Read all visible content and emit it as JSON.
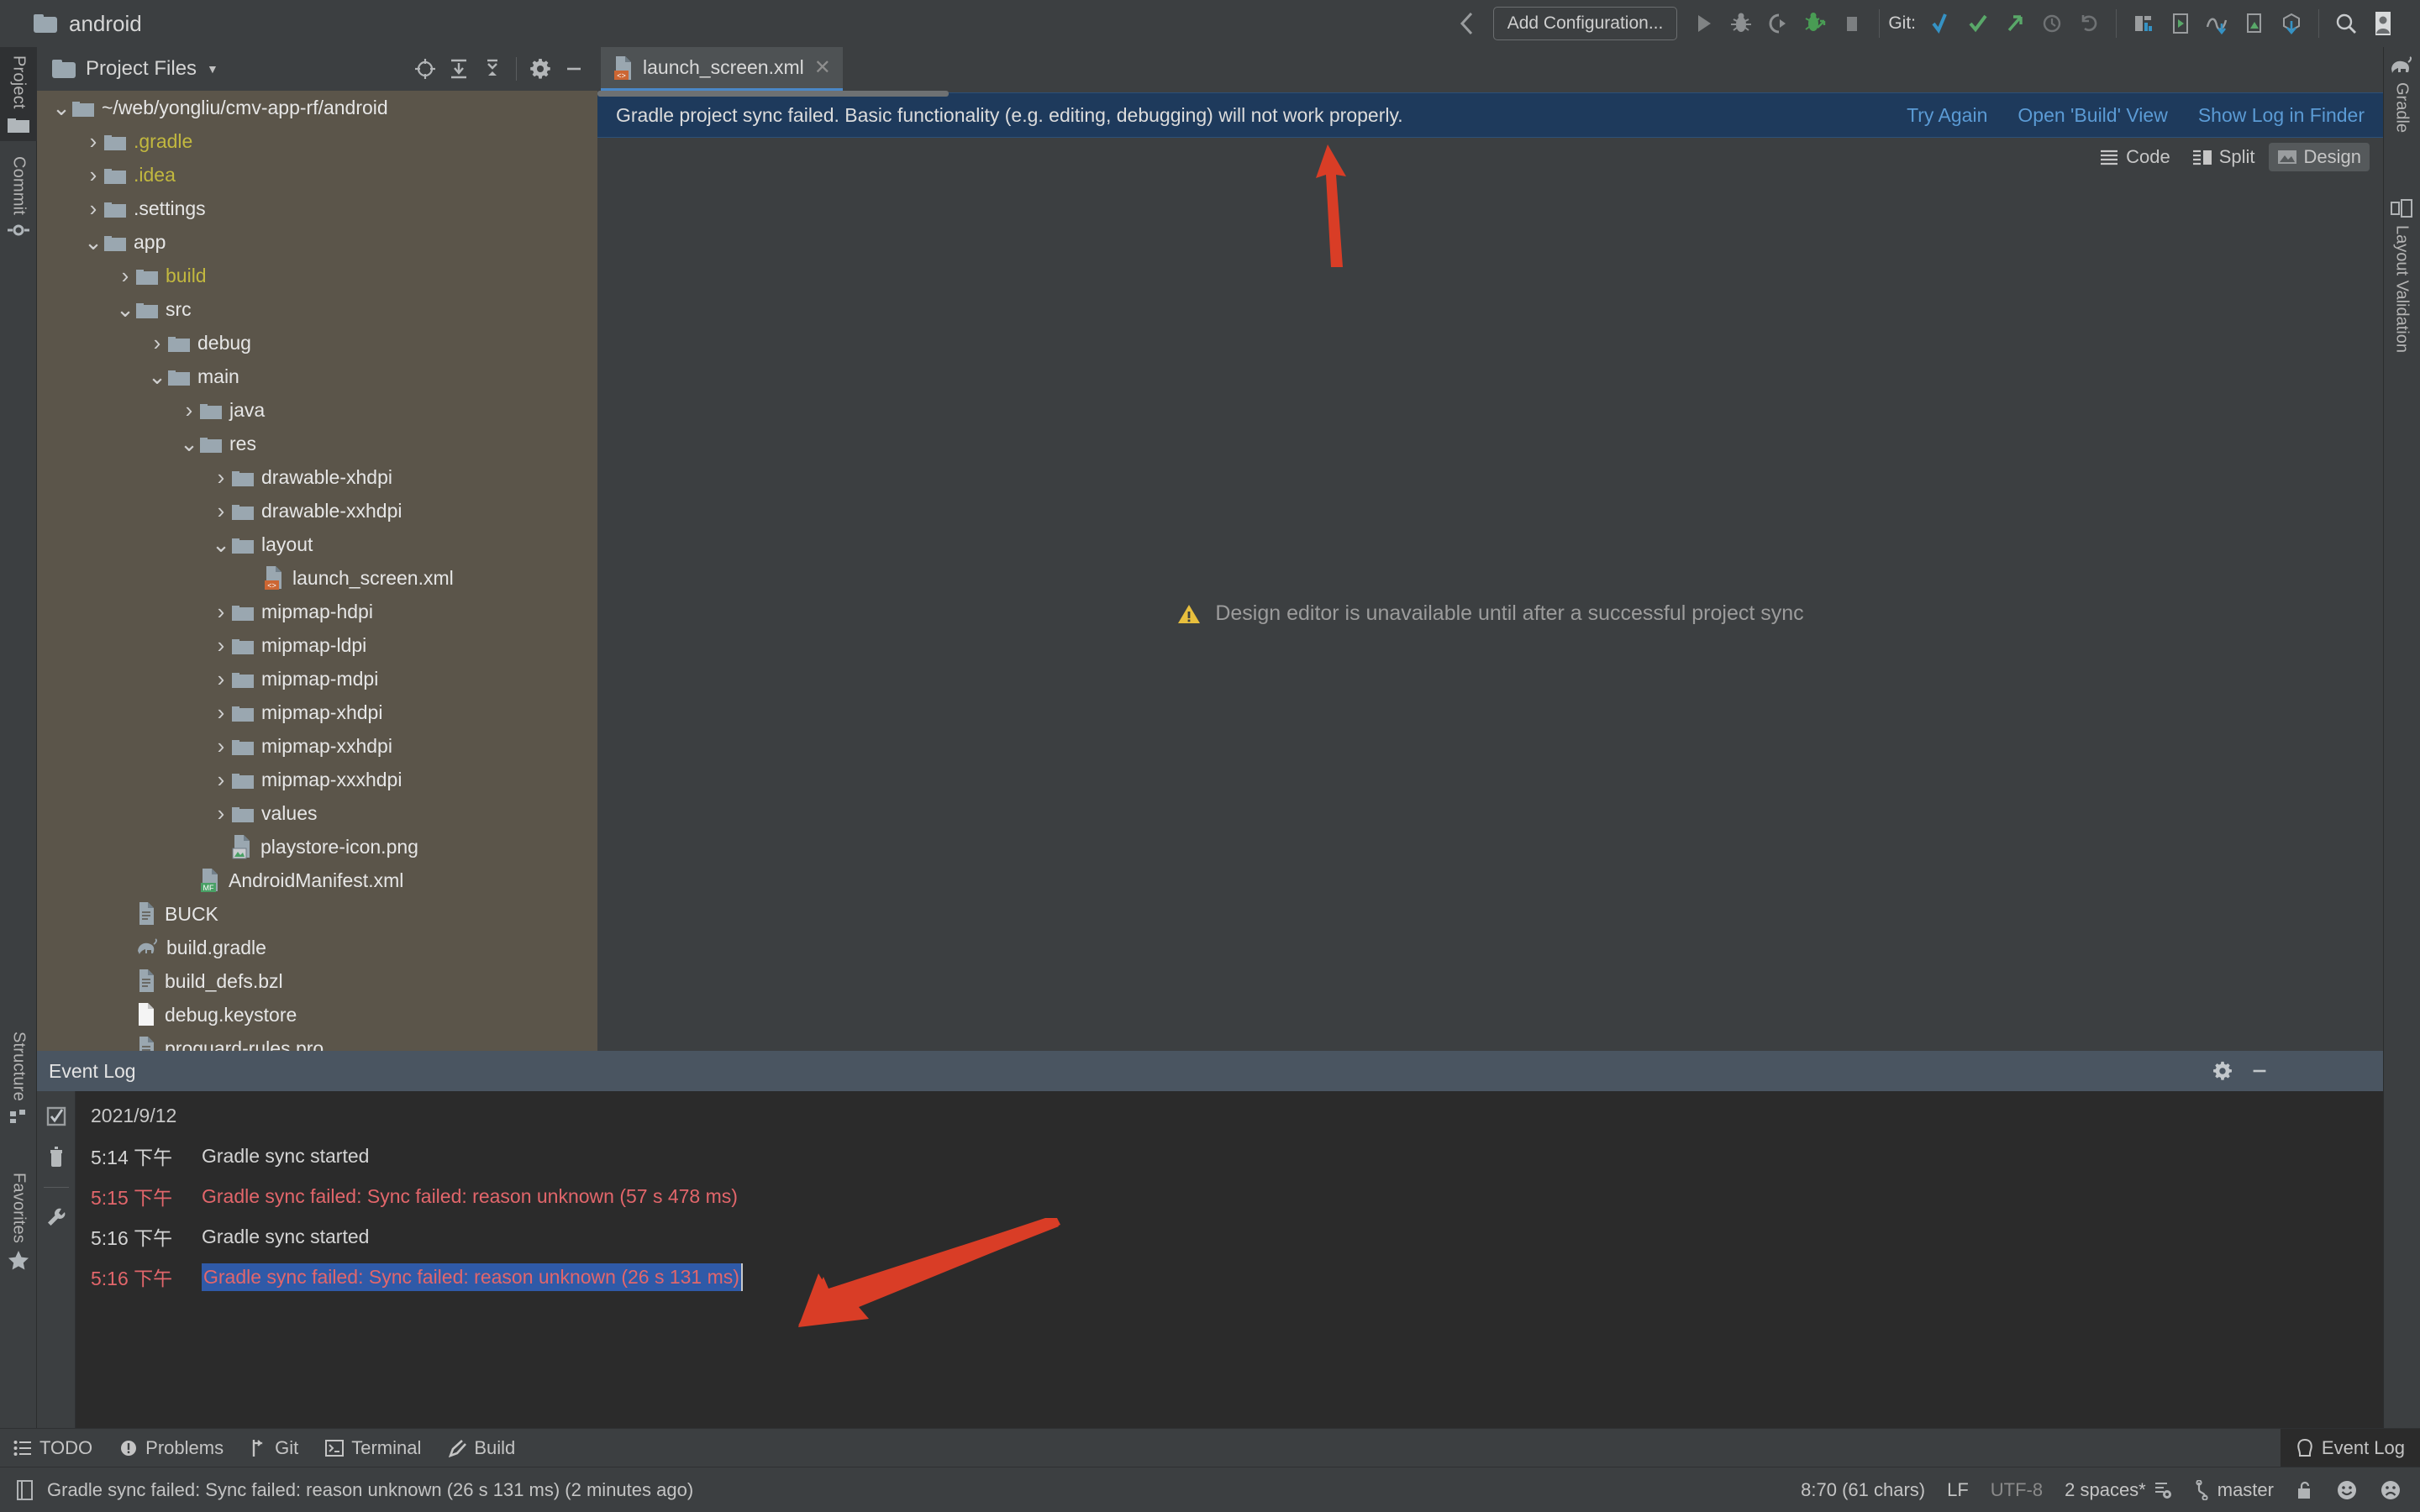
{
  "window": {
    "project_name": "android"
  },
  "toolbar": {
    "add_configuration": "Add Configuration...",
    "git_label": "Git:",
    "icons": [
      "back-arrow-icon",
      "run-icon",
      "debug-icon",
      "run-coverage-icon",
      "profile-icon",
      "stop-icon",
      "git-update-icon",
      "git-commit-icon",
      "git-push-icon",
      "git-history-icon",
      "git-rollback-icon",
      "sdk-manager-icon",
      "avd-manager-icon",
      "device-explorer-icon",
      "layout-inspector-icon",
      "apk-analyzer-icon",
      "search-icon",
      "profile-avatar-icon"
    ]
  },
  "left_tool_strip": {
    "tabs": [
      {
        "label": "Project",
        "icon": "folder-icon",
        "active": true
      },
      {
        "label": "Commit",
        "icon": "commit-icon",
        "active": false
      },
      {
        "label": "Structure",
        "icon": "structure-icon",
        "active": false
      },
      {
        "label": "Favorites",
        "icon": "star-icon",
        "active": false
      }
    ]
  },
  "right_tool_strip": {
    "tabs": [
      {
        "label": "Gradle",
        "icon": "gradle-elephant-icon"
      },
      {
        "label": "Layout Validation",
        "icon": "layout-validation-icon"
      }
    ]
  },
  "project_panel": {
    "title": "Project Files",
    "dropdown_icon": "chevron-down-icon",
    "header_icons": [
      "locate-target-icon",
      "expand-all-icon",
      "collapse-all-icon",
      "settings-gear-icon",
      "hide-panel-icon"
    ],
    "tree": [
      {
        "depth": 0,
        "arrow": "down",
        "icon": "folder",
        "label": "~/web/yongliu/cmv-app-rf/android",
        "yellow": false
      },
      {
        "depth": 1,
        "arrow": "right",
        "icon": "folder",
        "label": ".gradle",
        "yellow": true
      },
      {
        "depth": 1,
        "arrow": "right",
        "icon": "folder",
        "label": ".idea",
        "yellow": true
      },
      {
        "depth": 1,
        "arrow": "right",
        "icon": "folder",
        "label": ".settings",
        "yellow": false
      },
      {
        "depth": 1,
        "arrow": "down",
        "icon": "folder",
        "label": "app",
        "yellow": false
      },
      {
        "depth": 2,
        "arrow": "right",
        "icon": "folder",
        "label": "build",
        "yellow": true
      },
      {
        "depth": 2,
        "arrow": "down",
        "icon": "folder",
        "label": "src",
        "yellow": false
      },
      {
        "depth": 3,
        "arrow": "right",
        "icon": "folder",
        "label": "debug",
        "yellow": false
      },
      {
        "depth": 3,
        "arrow": "down",
        "icon": "folder",
        "label": "main",
        "yellow": false
      },
      {
        "depth": 4,
        "arrow": "right",
        "icon": "folder",
        "label": "java",
        "yellow": false
      },
      {
        "depth": 4,
        "arrow": "down",
        "icon": "folder",
        "label": "res",
        "yellow": false
      },
      {
        "depth": 5,
        "arrow": "right",
        "icon": "folder",
        "label": "drawable-xhdpi",
        "yellow": false
      },
      {
        "depth": 5,
        "arrow": "right",
        "icon": "folder",
        "label": "drawable-xxhdpi",
        "yellow": false
      },
      {
        "depth": 5,
        "arrow": "down",
        "icon": "folder",
        "label": "layout",
        "yellow": false
      },
      {
        "depth": 6,
        "arrow": "none",
        "icon": "xml-file",
        "label": "launch_screen.xml",
        "yellow": false
      },
      {
        "depth": 5,
        "arrow": "right",
        "icon": "folder",
        "label": "mipmap-hdpi",
        "yellow": false
      },
      {
        "depth": 5,
        "arrow": "right",
        "icon": "folder",
        "label": "mipmap-ldpi",
        "yellow": false
      },
      {
        "depth": 5,
        "arrow": "right",
        "icon": "folder",
        "label": "mipmap-mdpi",
        "yellow": false
      },
      {
        "depth": 5,
        "arrow": "right",
        "icon": "folder",
        "label": "mipmap-xhdpi",
        "yellow": false
      },
      {
        "depth": 5,
        "arrow": "right",
        "icon": "folder",
        "label": "mipmap-xxhdpi",
        "yellow": false
      },
      {
        "depth": 5,
        "arrow": "right",
        "icon": "folder",
        "label": "mipmap-xxxhdpi",
        "yellow": false
      },
      {
        "depth": 5,
        "arrow": "right",
        "icon": "folder",
        "label": "values",
        "yellow": false
      },
      {
        "depth": 5,
        "arrow": "none",
        "icon": "image-file",
        "label": "playstore-icon.png",
        "yellow": false
      },
      {
        "depth": 4,
        "arrow": "none",
        "icon": "manifest-file",
        "label": "AndroidManifest.xml",
        "yellow": false
      },
      {
        "depth": 2,
        "arrow": "none",
        "icon": "doc-file",
        "label": "BUCK",
        "yellow": false
      },
      {
        "depth": 2,
        "arrow": "none",
        "icon": "gradle-file",
        "label": "build.gradle",
        "yellow": false
      },
      {
        "depth": 2,
        "arrow": "none",
        "icon": "doc-file",
        "label": "build_defs.bzl",
        "yellow": false
      },
      {
        "depth": 2,
        "arrow": "none",
        "icon": "plain-file",
        "label": "debug.keystore",
        "yellow": false
      },
      {
        "depth": 2,
        "arrow": "none",
        "icon": "doc-file",
        "label": "proguard-rules.pro",
        "yellow": false
      }
    ]
  },
  "editor": {
    "tab": {
      "label": "launch_screen.xml",
      "icon": "xml-file-icon",
      "close_icon": "close-icon"
    },
    "sync_banner": {
      "message": "Gradle project sync failed. Basic functionality (e.g. editing, debugging) will not work properly.",
      "links": [
        "Try Again",
        "Open 'Build' View",
        "Show Log in Finder"
      ]
    },
    "modes": [
      {
        "label": "Code",
        "icon": "code-lines-icon",
        "selected": false
      },
      {
        "label": "Split",
        "icon": "split-view-icon",
        "selected": false
      },
      {
        "label": "Design",
        "icon": "design-view-icon",
        "selected": true
      }
    ],
    "canvas_message": "Design editor is unavailable until after a successful project sync",
    "canvas_icon": "warning-triangle-icon"
  },
  "event_log": {
    "title": "Event Log",
    "header_icons": [
      "settings-gear-icon",
      "hide-panel-icon"
    ],
    "gutter_icons": [
      "mark-all-read-icon",
      "delete-all-icon",
      "event-log-settings-icon"
    ],
    "date": "2021/9/12",
    "entries": [
      {
        "time": "5:14 下午",
        "message": "Gradle sync started",
        "level": "info",
        "selected": false
      },
      {
        "time": "5:15 下午",
        "message": "Gradle sync failed: Sync failed: reason unknown (57 s 478 ms)",
        "level": "error",
        "selected": false
      },
      {
        "time": "5:16 下午",
        "message": "Gradle sync started",
        "level": "info",
        "selected": false
      },
      {
        "time": "5:16 下午",
        "message": "Gradle sync failed: Sync failed: reason unknown (26 s 131 ms)",
        "level": "error",
        "selected": true
      }
    ]
  },
  "tool_window_bar": {
    "items": [
      {
        "label": "TODO",
        "icon": "todo-list-icon"
      },
      {
        "label": "Problems",
        "icon": "problems-icon"
      },
      {
        "label": "Git",
        "icon": "git-branch-icon"
      },
      {
        "label": "Terminal",
        "icon": "terminal-icon"
      },
      {
        "label": "Build",
        "icon": "build-hammer-icon"
      }
    ],
    "right_item": {
      "label": "Event Log",
      "icon": "event-log-icon"
    }
  },
  "status_bar": {
    "message": "Gradle sync failed: Sync failed: reason unknown (26 s 131 ms) (2 minutes ago)",
    "message_icon": "notification-icon",
    "caret_position": "8:70 (61 chars)",
    "line_separator": "LF",
    "encoding": "UTF-8",
    "indent": "2 spaces*",
    "indent_icon": "indent-config-icon",
    "branch": "master",
    "branch_icon": "git-branch-icon",
    "lock_icon": "unlocked-icon",
    "happy_icon": "happy-face-icon",
    "sad_icon": "sad-face-icon"
  },
  "annotations": {
    "arrow_color": "#d93d26",
    "arrows": [
      {
        "name": "arrow-to-sync-banner",
        "points_to": "sync-banner"
      },
      {
        "name": "arrow-to-selected-log-entry",
        "points_to": "event-log-selected-entry"
      }
    ]
  },
  "colors": {
    "accent_blue": "#4a88c7",
    "banner_bg": "#1e3a5c",
    "error_red": "#e2666b",
    "panel_bg": "#3c3f41",
    "tree_bg": "#5b554a",
    "selection_blue": "#2f5aa8",
    "excluded_yellow": "#c2b83f"
  }
}
